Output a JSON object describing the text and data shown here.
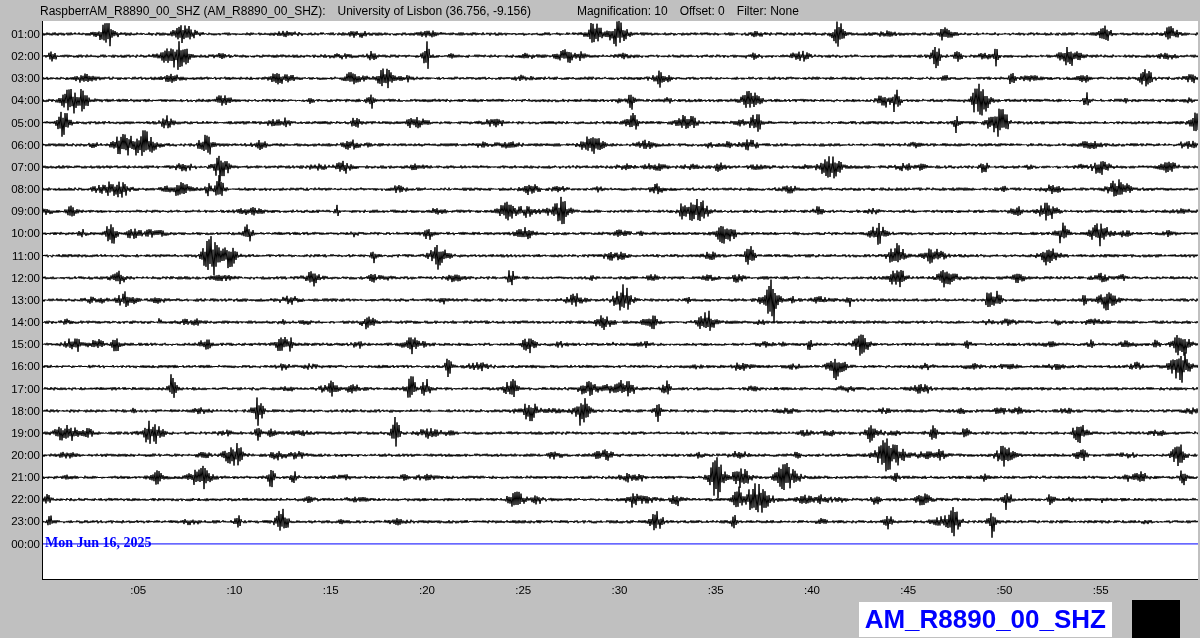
{
  "header": {
    "station": "RaspberrAM_R8890_00_SHZ (AM_R8890_00_SHZ):",
    "location": "University of Lisbon (36.756, -9.156)",
    "magnification": "Magnification: 10",
    "offset": "Offset: 0",
    "filter": "Filter: None"
  },
  "rows": [
    {
      "label": "01:00",
      "kind": "trace"
    },
    {
      "label": "02:00",
      "kind": "trace"
    },
    {
      "label": "03:00",
      "kind": "trace"
    },
    {
      "label": "04:00",
      "kind": "trace"
    },
    {
      "label": "05:00",
      "kind": "trace"
    },
    {
      "label": "06:00",
      "kind": "trace"
    },
    {
      "label": "07:00",
      "kind": "trace"
    },
    {
      "label": "08:00",
      "kind": "trace"
    },
    {
      "label": "09:00",
      "kind": "trace"
    },
    {
      "label": "10:00",
      "kind": "trace"
    },
    {
      "label": "11:00",
      "kind": "trace"
    },
    {
      "label": "12:00",
      "kind": "trace"
    },
    {
      "label": "13:00",
      "kind": "trace"
    },
    {
      "label": "14:00",
      "kind": "trace"
    },
    {
      "label": "15:00",
      "kind": "trace"
    },
    {
      "label": "16:00",
      "kind": "trace"
    },
    {
      "label": "17:00",
      "kind": "trace"
    },
    {
      "label": "18:00",
      "kind": "trace"
    },
    {
      "label": "19:00",
      "kind": "trace"
    },
    {
      "label": "20:00",
      "kind": "trace"
    },
    {
      "label": "21:00",
      "kind": "trace"
    },
    {
      "label": "22:00",
      "kind": "trace"
    },
    {
      "label": "23:00",
      "kind": "trace"
    },
    {
      "label": "00:00",
      "kind": "current",
      "date": "Mon Jun 16, 2025"
    }
  ],
  "x_ticks": [
    ":05",
    ":10",
    ":15",
    ":20",
    ":25",
    ":30",
    ":35",
    ":40",
    ":45",
    ":50",
    ":55"
  ],
  "station_label": "AM_R8890_00_SHZ"
}
